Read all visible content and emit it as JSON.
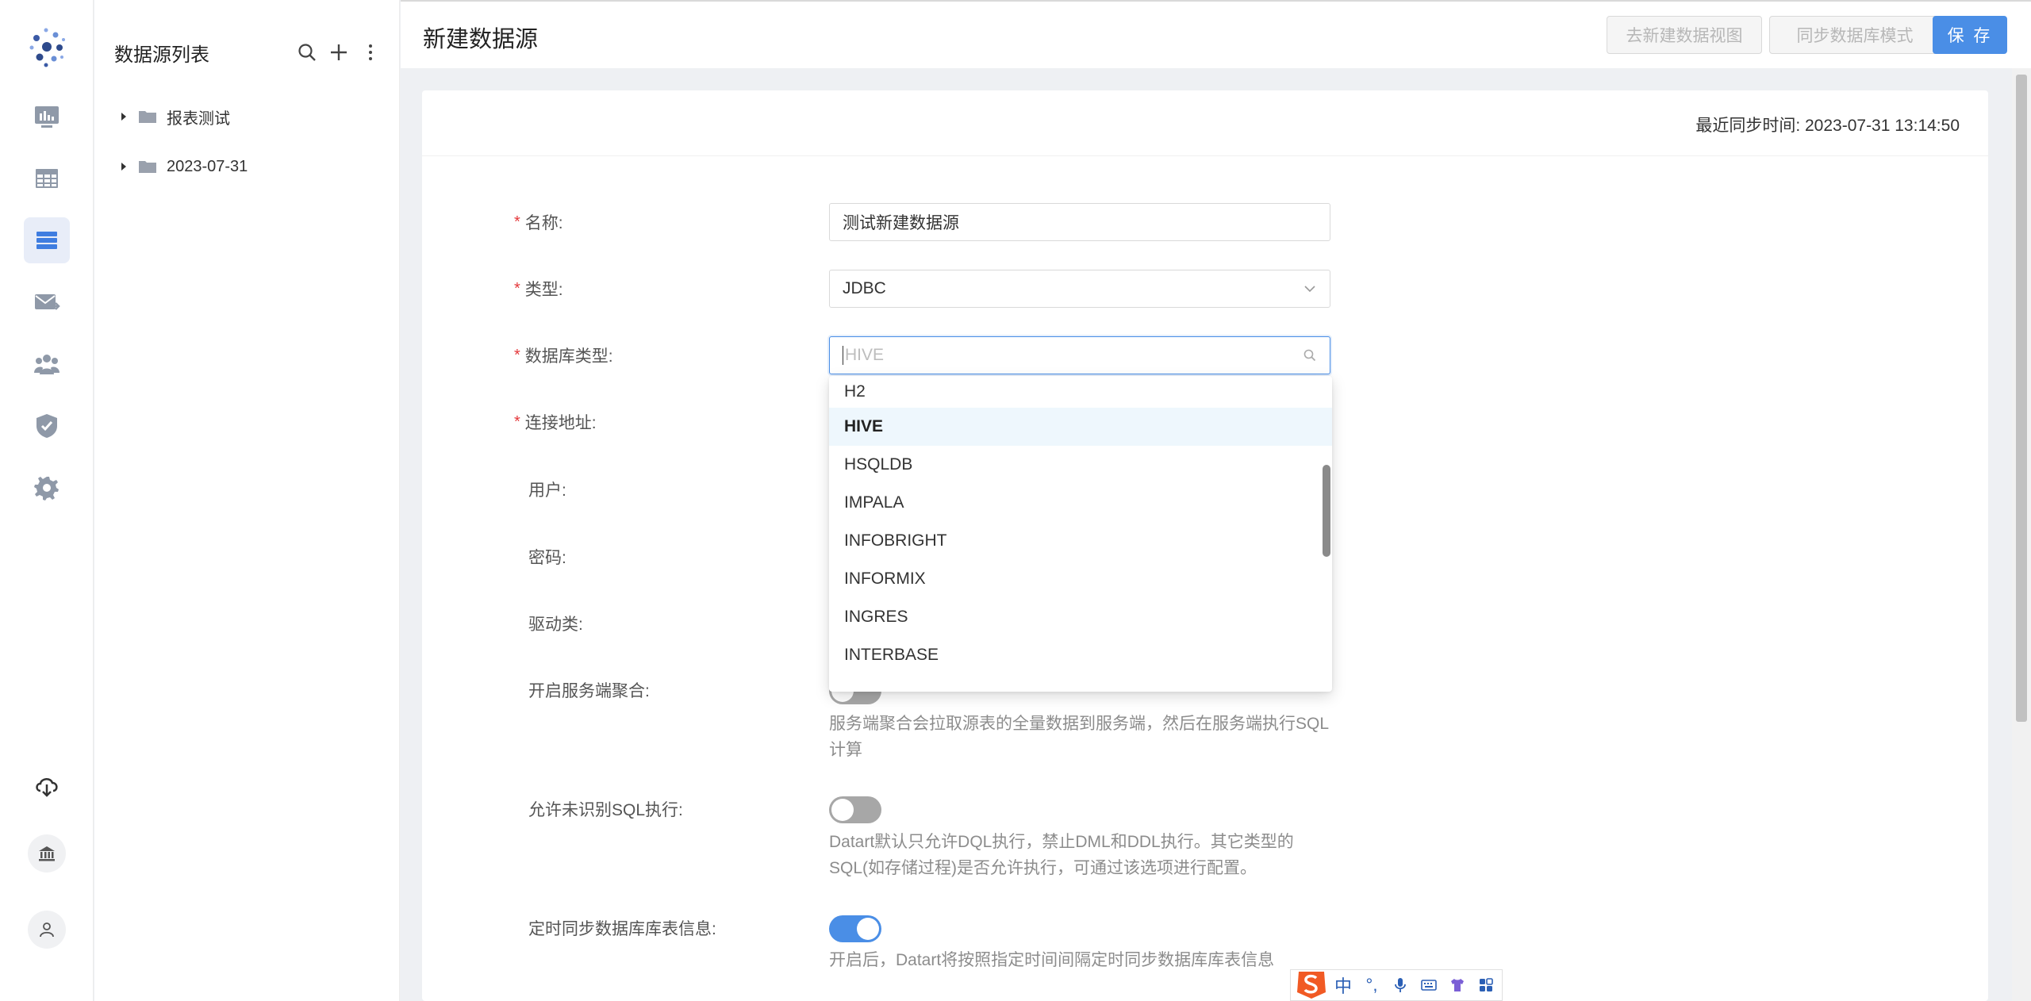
{
  "app": {
    "nav": [
      {
        "name": "dashboard-icon",
        "active": false
      },
      {
        "name": "table-icon",
        "active": false
      },
      {
        "name": "datasource-list-icon",
        "active": true
      },
      {
        "name": "mail-icon",
        "active": false
      },
      {
        "name": "users-icon",
        "active": false
      },
      {
        "name": "shield-check-icon",
        "active": false
      },
      {
        "name": "gear-icon",
        "active": false
      }
    ],
    "bottom_nav": [
      "cloud-download-icon",
      "bank-icon",
      "user-icon"
    ]
  },
  "sidebar": {
    "title": "数据源列表",
    "items": [
      {
        "label": "报表测试"
      },
      {
        "label": "2023-07-31"
      }
    ]
  },
  "header": {
    "title": "新建数据源",
    "btn_create_view": "去新建数据视图",
    "btn_sync_schema": "同步数据库模式",
    "btn_save": "保 存"
  },
  "form": {
    "sync_time": "最近同步时间: 2023-07-31 13:14:50",
    "name_label": "名称:",
    "name_value": "测试新建数据源",
    "type_label": "类型:",
    "type_value": "JDBC",
    "dbtype_label": "数据库类型:",
    "dbtype_placeholder": "HIVE",
    "url_label": "连接地址:",
    "user_label": "用户:",
    "password_label": "密码:",
    "driver_label": "驱动类:",
    "server_agg_label": "开启服务端聚合:",
    "server_agg_on": false,
    "server_agg_help": "服务端聚合会拉取源表的全量数据到服务端，然后在服务端执行SQL计算",
    "unknown_sql_label": "允许未识别SQL执行:",
    "unknown_sql_on": false,
    "unknown_sql_help": "Datart默认只允许DQL执行，禁止DML和DDL执行。其它类型的SQL(如存储过程)是否允许执行，可通过该选项进行配置。",
    "schedule_sync_label": "定时同步数据库库表信息:",
    "schedule_sync_on": true,
    "schedule_sync_help": "开启后，Datart将按照指定时间间隔定时同步数据库库表信息"
  },
  "dropdown": {
    "options": [
      "H2",
      "HIVE",
      "HSQLDB",
      "IMPALA",
      "INFOBRIGHT",
      "INFORMIX",
      "INGRES",
      "INTERBASE"
    ],
    "selected": "HIVE"
  },
  "ime": {
    "lang": "中",
    "punct": "°,"
  },
  "colors": {
    "accent": "#4a8ee6",
    "required": "#e4393c",
    "selected_bg": "#eef7fd"
  }
}
